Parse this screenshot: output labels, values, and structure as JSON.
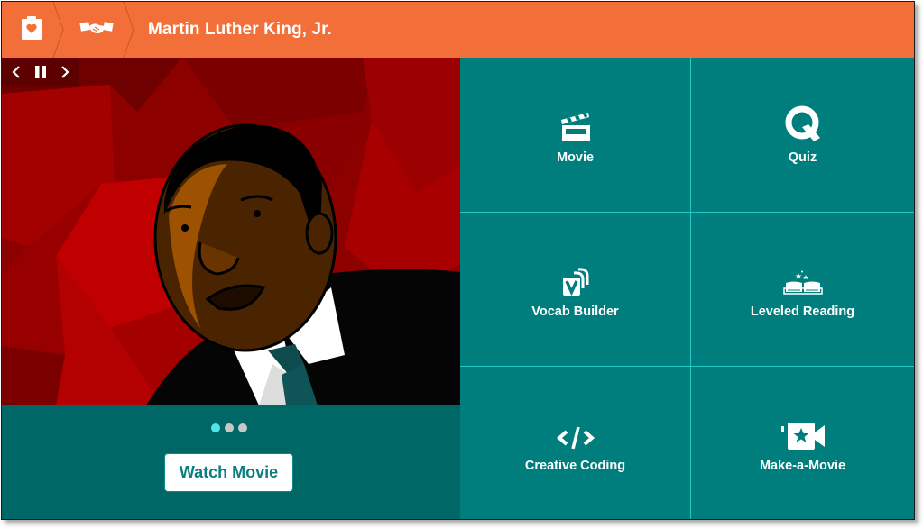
{
  "header": {
    "home_icon": "clipboard-heart-icon",
    "category_icon": "handshake-icon",
    "title": "Martin Luther King, Jr.",
    "background_color": "#f26f39"
  },
  "media": {
    "controls": {
      "prev_icon": "chevron-left-icon",
      "pause_icon": "pause-icon",
      "next_icon": "chevron-right-icon"
    },
    "slide_description": "Cartoon illustration of Martin Luther King, Jr. in a suit and tie on a red geometric background",
    "slides_total": 3,
    "active_slide": 1,
    "watch_button_label": "Watch Movie"
  },
  "features": [
    {
      "label": "Movie",
      "icon": "clapperboard-icon"
    },
    {
      "label": "Quiz",
      "icon": "quiz-q-icon"
    },
    {
      "label": "Vocab Builder",
      "icon": "vocab-cards-icon"
    },
    {
      "label": "Leveled Reading",
      "icon": "open-book-stars-icon"
    },
    {
      "label": "Creative Coding",
      "icon": "code-brackets-icon"
    },
    {
      "label": "Make-a-Movie",
      "icon": "video-camera-star-icon"
    }
  ],
  "colors": {
    "accent_orange": "#f26f39",
    "teal": "#007e7e",
    "dark_teal": "#006767",
    "grid_line": "#27c9c6",
    "active_dot": "#4ee6ea"
  }
}
